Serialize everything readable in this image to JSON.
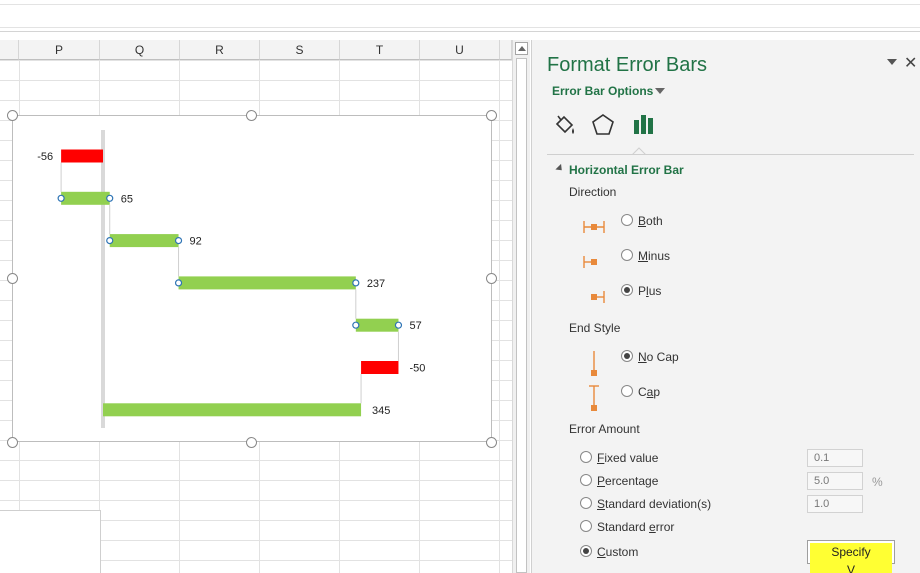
{
  "sheet": {
    "columns": [
      "P",
      "Q",
      "R",
      "S",
      "T",
      "U"
    ]
  },
  "chart_data": {
    "type": "bar",
    "title": "",
    "bars": [
      {
        "label": "-56",
        "value": -56,
        "color": "#ff0000"
      },
      {
        "label": "65",
        "value": 65,
        "color": "#92d050"
      },
      {
        "label": "92",
        "value": 92,
        "color": "#92d050"
      },
      {
        "label": "237",
        "value": 237,
        "color": "#92d050"
      },
      {
        "label": "57",
        "value": 57,
        "color": "#92d050"
      },
      {
        "label": "-50",
        "value": -50,
        "color": "#ff0000"
      },
      {
        "label": "345",
        "value": 345,
        "color": "#92d050"
      }
    ]
  },
  "pane": {
    "title": "Format Error Bars",
    "subtitle": "Error Bar Options",
    "section": "Horizontal Error Bar",
    "direction": {
      "heading": "Direction",
      "options": [
        {
          "pre": "",
          "key": "B",
          "post": "oth",
          "selected": false
        },
        {
          "pre": "",
          "key": "M",
          "post": "inus",
          "selected": false
        },
        {
          "pre": "P",
          "key": "l",
          "post": "us",
          "selected": true
        }
      ]
    },
    "end_style": {
      "heading": "End Style",
      "options": [
        {
          "pre": "",
          "key": "N",
          "post": "o Cap",
          "selected": true
        },
        {
          "pre": "C",
          "key": "a",
          "post": "p",
          "selected": false
        }
      ]
    },
    "error_amount": {
      "heading": "Error Amount",
      "options": [
        {
          "pre": "",
          "key": "F",
          "post": "ixed value",
          "selected": false,
          "value": "0.1"
        },
        {
          "pre": "",
          "key": "P",
          "post": "ercentage",
          "selected": false,
          "value": "5.0"
        },
        {
          "pre": "",
          "key": "S",
          "post": "tandard deviation(s)",
          "selected": false,
          "value": "1.0"
        },
        {
          "pre": "Standard ",
          "key": "e",
          "post": "rror",
          "selected": false,
          "value": ""
        },
        {
          "pre": "",
          "key": "C",
          "post": "ustom",
          "selected": true,
          "value": ""
        }
      ],
      "percent_sign": "%",
      "specify_pre": "Specify ",
      "specify_key": "V",
      "specify_post": "alue"
    },
    "accent": "#217346"
  }
}
